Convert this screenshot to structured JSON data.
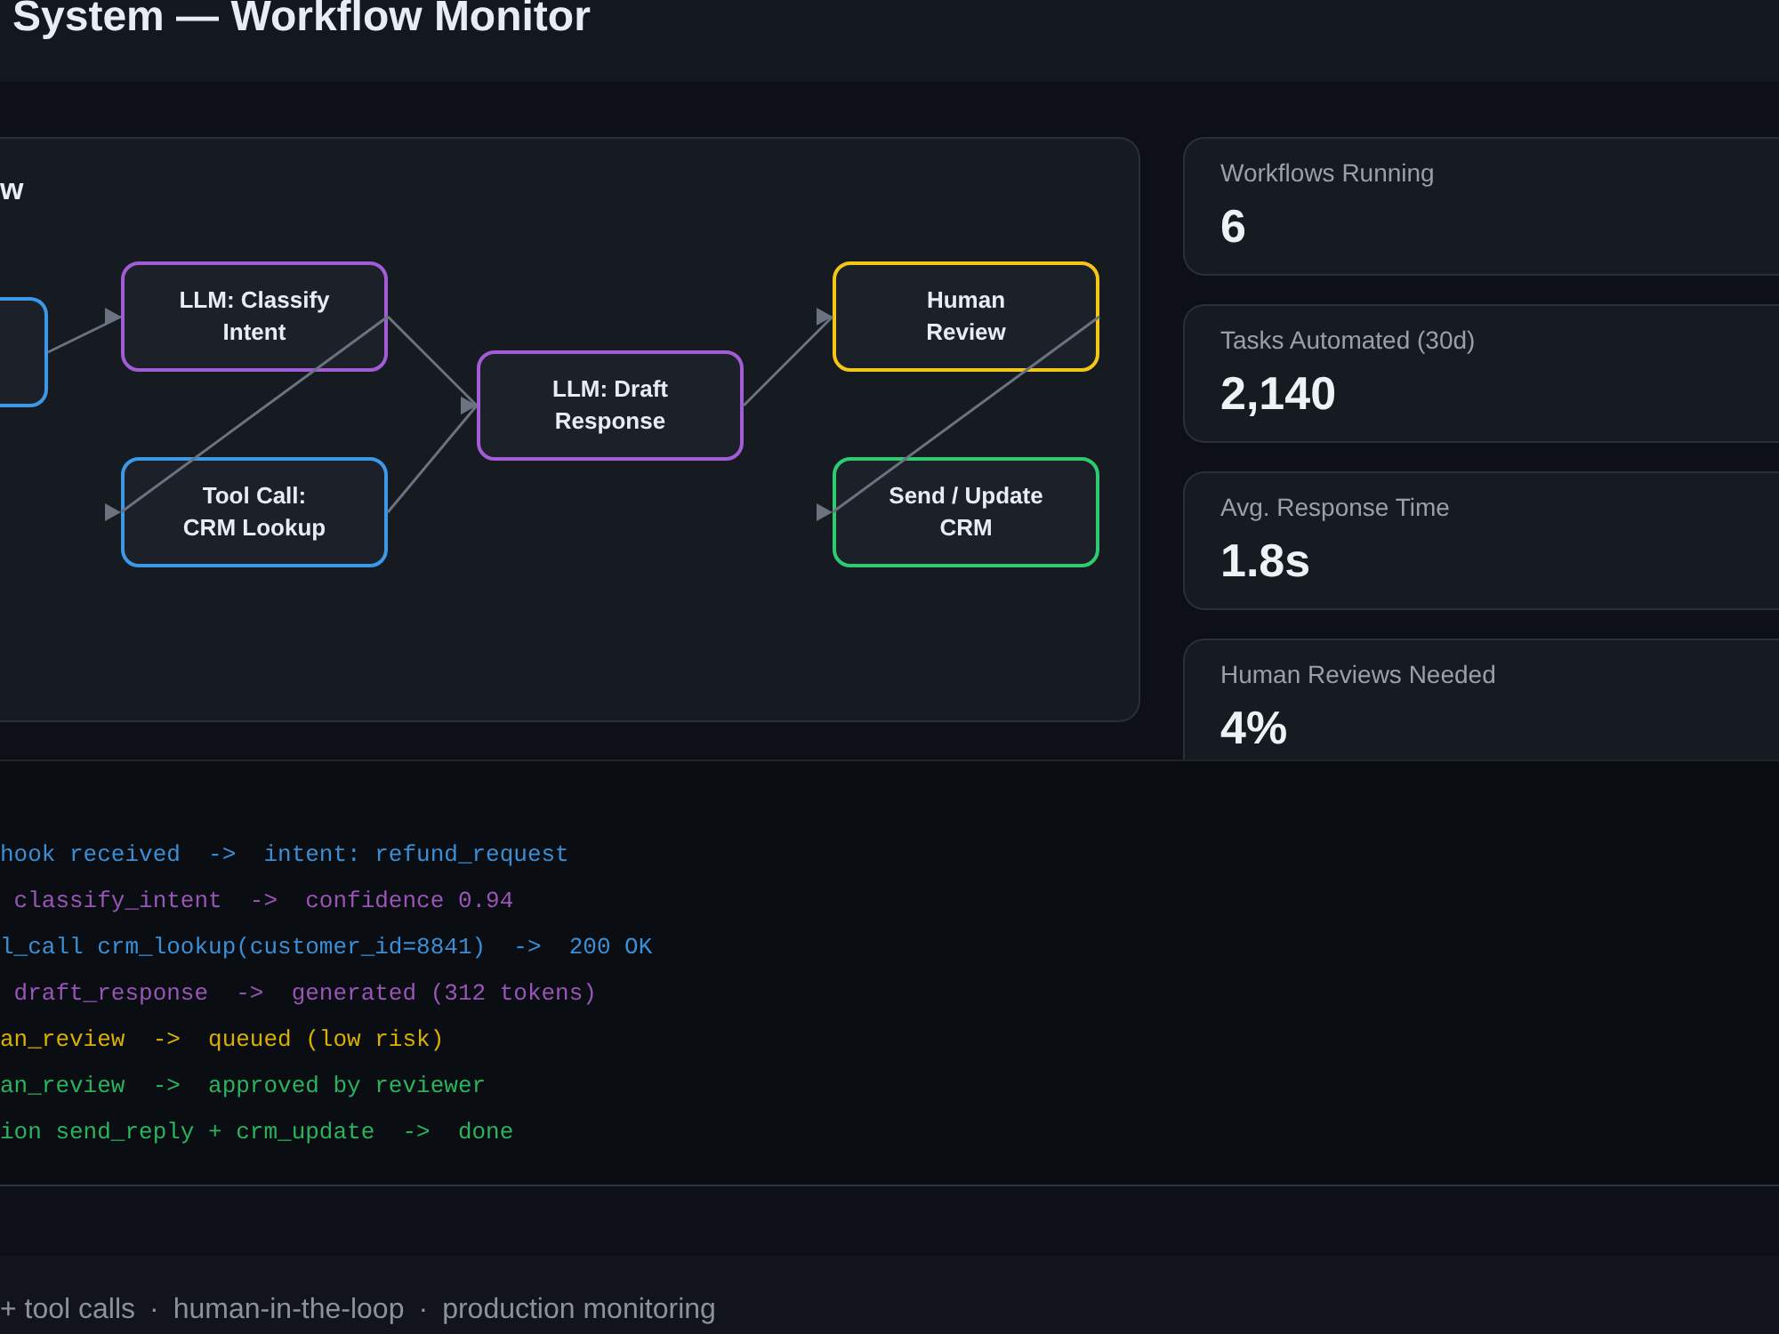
{
  "header": {
    "title": "System — Workflow Monitor"
  },
  "workflow": {
    "title": "w",
    "nodes": [
      {
        "color": "#3b99e8"
      },
      {
        "lines": [
          "LLM: Classify",
          "Intent"
        ],
        "color": "#a15cd6"
      },
      {
        "lines": [
          "Tool Call:",
          "CRM Lookup"
        ],
        "color": "#3b99e8"
      },
      {
        "lines": [
          "LLM: Draft",
          "Response"
        ],
        "color": "#a15cd6"
      },
      {
        "lines": [
          "Human",
          "Review"
        ],
        "color": "#f5c518"
      },
      {
        "lines": [
          "Send / Update",
          "CRM"
        ],
        "color": "#2ecc71"
      }
    ]
  },
  "stats": [
    {
      "label": "Workflows Running",
      "value": "6"
    },
    {
      "label": "Tasks Automated (30d)",
      "value": "2,140"
    },
    {
      "label": "Avg. Response Time",
      "value": "1.8s"
    },
    {
      "label": "Human Reviews Needed",
      "value": "4%"
    }
  ],
  "log": {
    "lines": [
      {
        "text": "hook received  ->  intent: refund_request",
        "color": "#3b8fd6"
      },
      {
        "text": " classify_intent  ->  confidence 0.94",
        "color": "#9a55b8"
      },
      {
        "text": "l_call crm_lookup(customer_id=8841)  ->  200 OK",
        "color": "#3b8fd6"
      },
      {
        "text": " draft_response  ->  generated (312 tokens)",
        "color": "#9a55b8"
      },
      {
        "text": "an_review  ->  queued (low risk)",
        "color": "#dcb000"
      },
      {
        "text": "an_review  ->  approved by reviewer",
        "color": "#2bb35e"
      },
      {
        "text": "ion send_reply + crm_update  ->  done",
        "color": "#2bb35e"
      }
    ]
  },
  "footer": {
    "segments": [
      "+ tool calls",
      "·",
      "human-in-the-loop",
      "·",
      "production monitoring"
    ]
  }
}
